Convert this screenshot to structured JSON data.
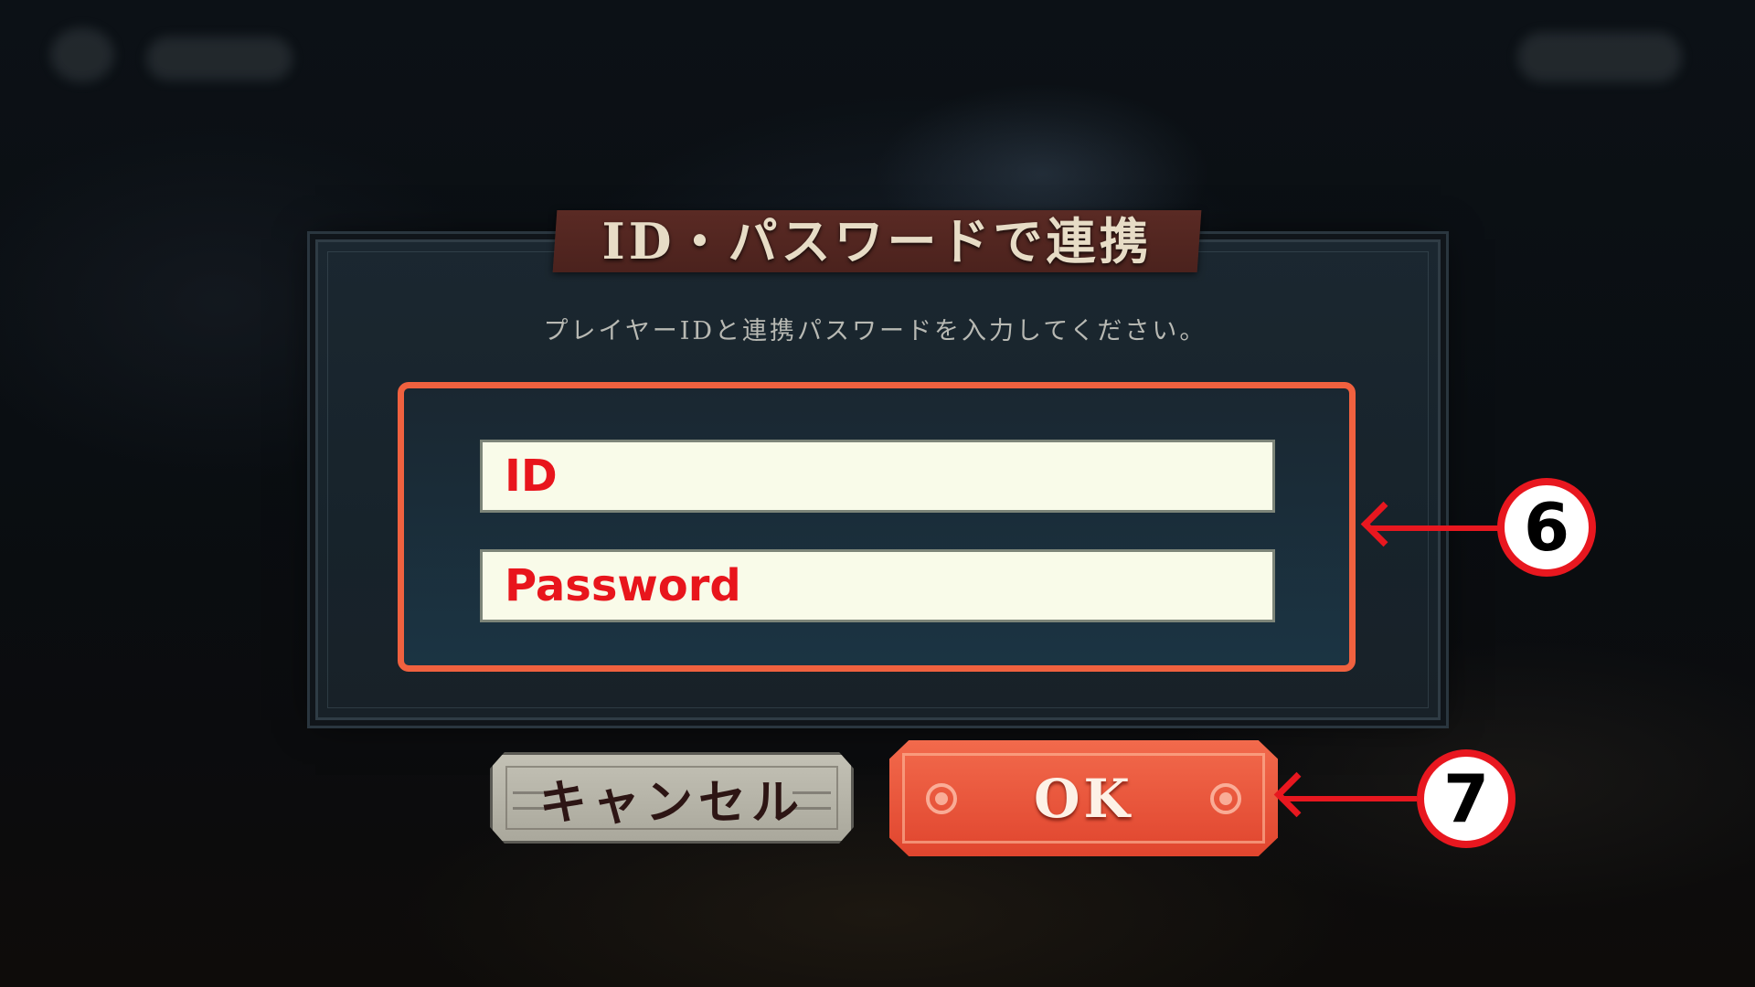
{
  "dialog": {
    "title": "ID・パスワードで連携",
    "instruction": "プレイヤーIDと連携パスワードを入力してください。"
  },
  "form": {
    "id_placeholder": "ID",
    "password_placeholder": "Password"
  },
  "buttons": {
    "cancel_label": "キャンセル",
    "ok_label": "OK"
  },
  "annotations": {
    "inputs_step": "6",
    "ok_step": "7",
    "highlight_color": "#f0613f",
    "arrow_color": "#e8171f"
  }
}
